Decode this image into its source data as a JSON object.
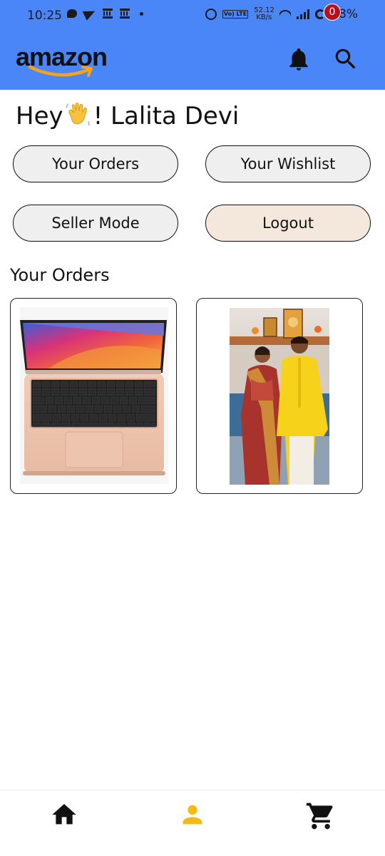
{
  "status_bar": {
    "time": "10:25",
    "network_speed_value": "52.12",
    "network_speed_unit": "KB/s",
    "network_type": "Vo) LTE",
    "battery": "58%",
    "left_icons": [
      "chat-bubble-icon",
      "telegram-icon",
      "bank-icon",
      "bank-icon",
      "dot-icon"
    ],
    "right_icons": [
      "alarm-icon",
      "volte-icon",
      "wifi-icon",
      "signal-icon",
      "battery-icon"
    ]
  },
  "header": {
    "logo_text": "amazon",
    "background_color": "#4a86f7",
    "icons": [
      "bell-icon",
      "search-icon"
    ]
  },
  "greeting": {
    "prefix": "Hey",
    "emoji": "waving-hand-icon",
    "suffix": "! Lalita Devi"
  },
  "actions": {
    "orders_label": "Your Orders",
    "wishlist_label": "Your Wishlist",
    "seller_label": "Seller Mode",
    "logout_label": "Logout"
  },
  "orders_section": {
    "title": "Your Orders",
    "items": [
      {
        "image": "laptop-product-image"
      },
      {
        "image": "couple-photo-image"
      }
    ]
  },
  "bottom_nav": {
    "items": [
      "home-icon",
      "account-icon",
      "cart-icon"
    ],
    "active_color": "#f6bb10",
    "cart_count": "0",
    "badge_color": "#b3111f"
  }
}
